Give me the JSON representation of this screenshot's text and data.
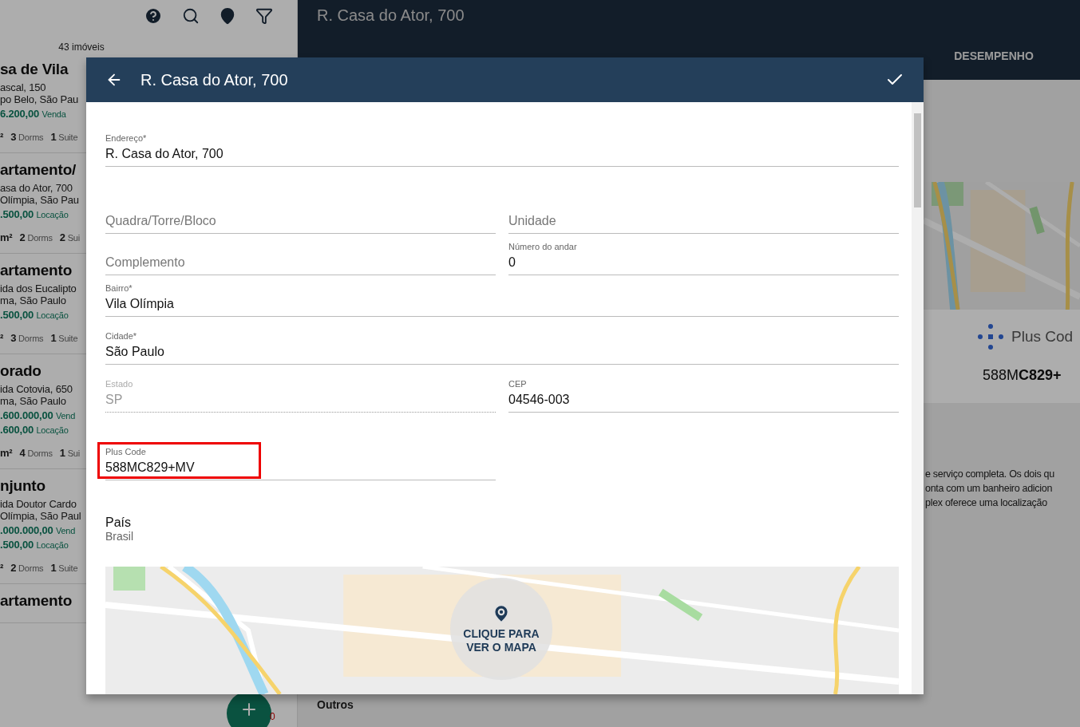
{
  "list_panel": {
    "count": "43 imóveis",
    "items": [
      {
        "title": "sa de Vila",
        "lines": [
          "ascal, 150",
          "po Belo, São Pau"
        ],
        "prices": [
          {
            "amount": "6.200,00",
            "type": "Venda"
          }
        ],
        "area_unit": "²",
        "stats": [
          "**3** Dorms",
          "**1** Suite"
        ]
      },
      {
        "title": "artamento/",
        "lines": [
          "asa do Ator, 700",
          "Olímpia, São Pau"
        ],
        "prices": [
          {
            "amount": ".500,00",
            "type": "Locação"
          }
        ],
        "area_unit": "m²",
        "stats": [
          "**2** Dorms",
          "**2** Sui"
        ]
      },
      {
        "title": "artamento",
        "lines": [
          "ida dos Eucalipto",
          "ma, São Paulo"
        ],
        "prices": [
          {
            "amount": ".500,00",
            "type": "Locação"
          }
        ],
        "area_unit": "²",
        "stats": [
          "**3** Dorms",
          "**1** Suite"
        ]
      },
      {
        "title": "orado",
        "lines": [
          "ida Cotovia, 650",
          "ma, São Paulo"
        ],
        "prices": [
          {
            "amount": ".600.000,00",
            "type": "Vend"
          },
          {
            "amount": ".600,00",
            "type": "Locação"
          }
        ],
        "area_unit": "m²",
        "stats": [
          "**4** Dorms",
          "**1** Sui"
        ]
      },
      {
        "title": "njunto",
        "lines": [
          "ida Doutor Cardo",
          "Olímpia, São Paul"
        ],
        "prices": [
          {
            "amount": ".000.000,00",
            "type": "Vend"
          },
          {
            "amount": ".500,00",
            "type": "Locação"
          }
        ],
        "area_unit": "²",
        "stats": [
          "**2** Dorms",
          "**1** Suite"
        ]
      },
      {
        "title": "artamento"
      }
    ],
    "badge": "0"
  },
  "detail_panel": {
    "title": "R. Casa do Ator, 700",
    "tabs": [
      {
        "label": "DESEMPENHO",
        "selected": false
      }
    ],
    "plus_code_logo": "Plus Cod",
    "plus_code": "588M**C829+**",
    "description": [
      "e serviço completa. Os dois qu",
      "onta com um banheiro adicion",
      "plex oferece uma localização"
    ],
    "section": "Outros"
  },
  "modal": {
    "title": "R. Casa do Ator, 700",
    "rows": [
      [
        {
          "label": "Endereço*",
          "value": "R. Casa do Ator, 700"
        }
      ],
      [
        {
          "placeholder": "Quadra/Torre/Bloco"
        },
        {
          "placeholder": "Unidade"
        }
      ],
      [
        {
          "placeholder": "Complemento"
        },
        {
          "label": "Número do andar",
          "value": "0"
        }
      ],
      [
        {
          "label": "Bairro*",
          "value": "Vila Olímpia"
        }
      ],
      [
        {
          "label": "Cidade*",
          "value": "São Paulo"
        }
      ],
      [
        {
          "label": "Estado",
          "value": "SP",
          "disabled": true
        },
        {
          "label": "CEP",
          "value": "04546-003"
        }
      ],
      [
        {
          "label": "Plus Code",
          "value": "588MC829+MV",
          "highlighted": true
        }
      ]
    ],
    "country": {
      "label": "País",
      "value": "Brasil"
    },
    "map_button": "CLIQUE PARA VER O MAPA"
  }
}
